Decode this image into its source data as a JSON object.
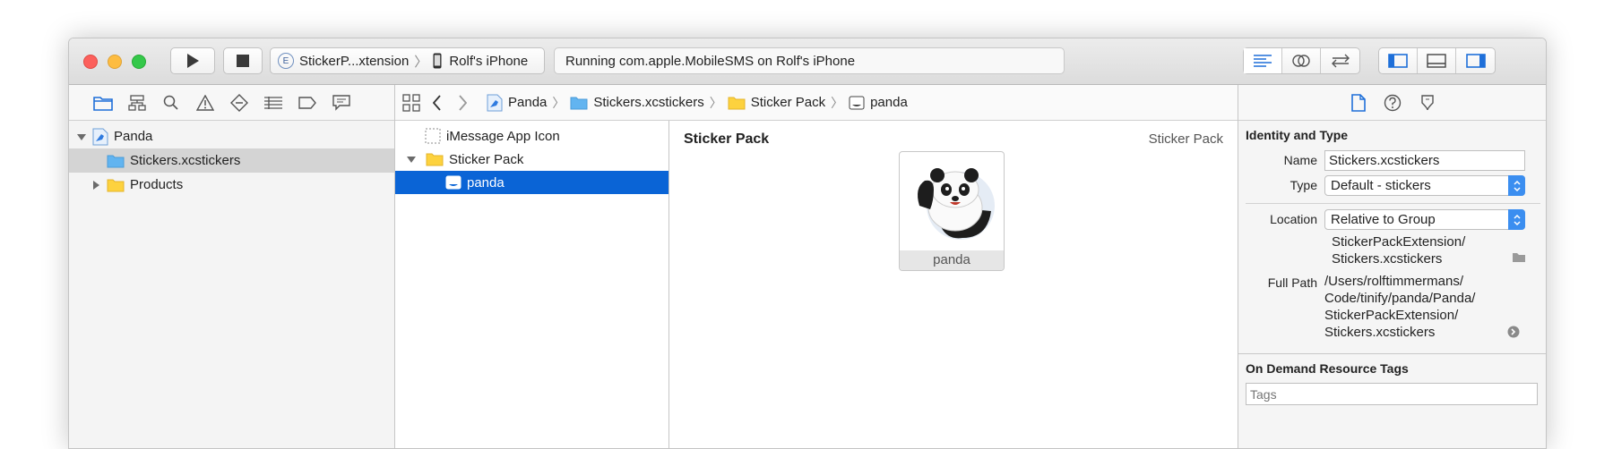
{
  "toolbar": {
    "scheme_name": "StickerP...xtension",
    "device_name": "Rolf's iPhone",
    "status_text": "Running com.apple.MobileSMS on Rolf's iPhone",
    "scheme_badge": "E"
  },
  "navigator": {
    "items": [
      {
        "label": "Panda"
      },
      {
        "label": "Stickers.xcstickers"
      },
      {
        "label": "Products"
      }
    ]
  },
  "jumpbar": {
    "crumbs": [
      "Panda",
      "Stickers.xcstickers",
      "Sticker Pack",
      "panda"
    ]
  },
  "outline": {
    "items": [
      {
        "label": "iMessage App Icon"
      },
      {
        "label": "Sticker Pack"
      },
      {
        "label": "panda"
      }
    ]
  },
  "editor": {
    "title": "Sticker Pack",
    "type_label": "Sticker Pack",
    "sticker_name": "panda"
  },
  "inspector": {
    "identity_title": "Identity and Type",
    "name_label": "Name",
    "name_value": "Stickers.xcstickers",
    "type_label": "Type",
    "type_value": "Default - stickers",
    "location_label": "Location",
    "location_value": "Relative to Group",
    "location_path_1": "StickerPackExtension/",
    "location_path_2": "Stickers.xcstickers",
    "fullpath_label": "Full Path",
    "fullpath_1": "/Users/rolftimmermans/",
    "fullpath_2": "Code/tinify/panda/Panda/",
    "fullpath_3": "StickerPackExtension/",
    "fullpath_4": "Stickers.xcstickers",
    "tags_title": "On Demand Resource Tags",
    "tags_placeholder": "Tags"
  },
  "colors": {
    "selection_blue": "#0a64d6",
    "accent_blue": "#3b8ef0",
    "folder_yellow": "#fdd23e"
  }
}
